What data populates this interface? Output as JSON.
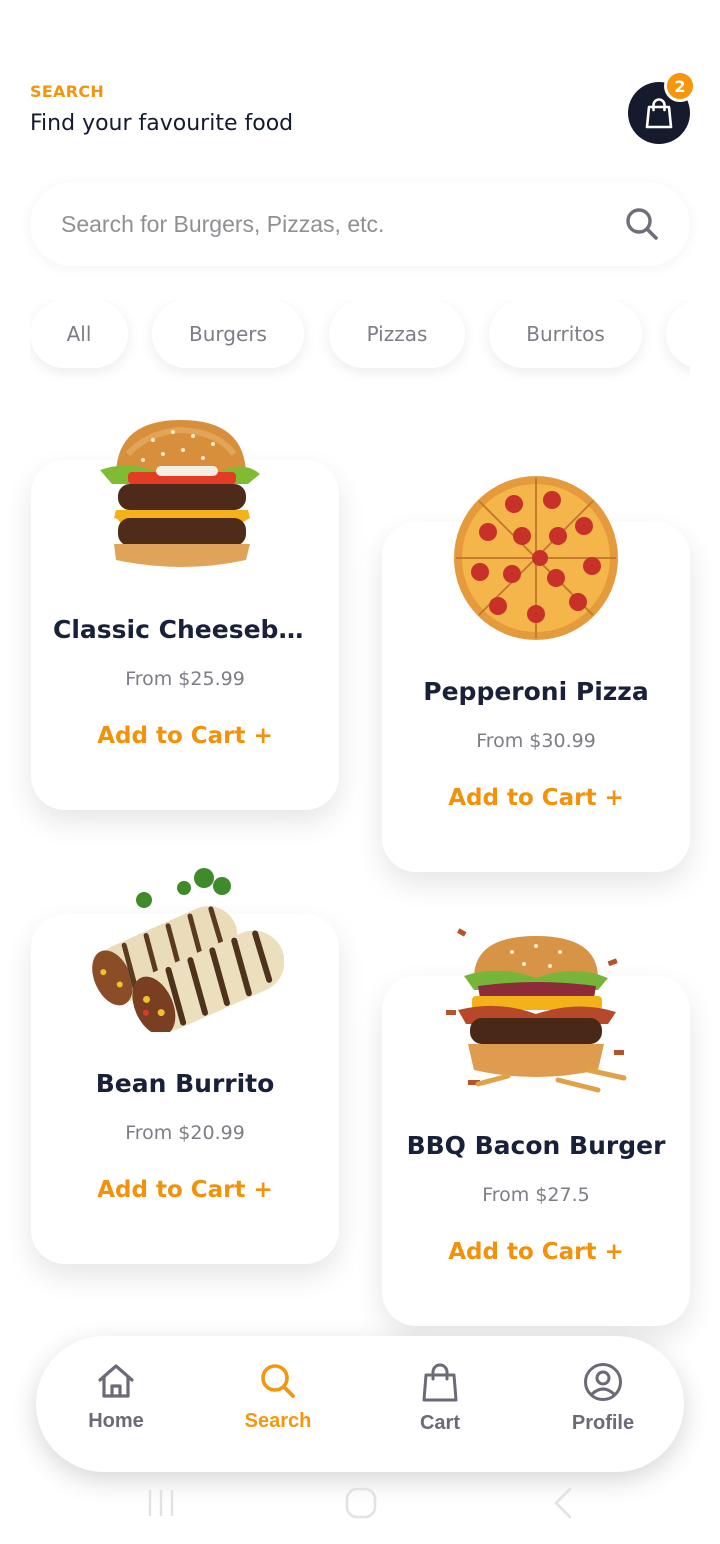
{
  "header": {
    "eyebrow": "SEARCH",
    "title": "Find your favourite food"
  },
  "cart_fab": {
    "icon": "shopping-bag-icon",
    "badge_count": "2"
  },
  "search": {
    "placeholder": "Search for Burgers, Pizzas, etc.",
    "value": "",
    "icon": "search-icon"
  },
  "categories": [
    "All",
    "Burgers",
    "Pizzas",
    "Burritos"
  ],
  "products": [
    {
      "name": "Classic Cheeseburger",
      "price": "From $25.99",
      "action": "Add to Cart +"
    },
    {
      "name": "Pepperoni Pizza",
      "price": "From $30.99",
      "action": "Add to Cart +"
    },
    {
      "name": "Bean Burrito",
      "price": "From $20.99",
      "action": "Add to Cart +"
    },
    {
      "name": "BBQ Bacon Burger",
      "price": "From $27.5",
      "action": "Add to Cart +"
    }
  ],
  "bottom_nav": [
    {
      "label": "Home",
      "icon": "home-icon",
      "active": false
    },
    {
      "label": "Search",
      "icon": "search-icon",
      "active": true
    },
    {
      "label": "Cart",
      "icon": "shopping-bag-icon",
      "active": false
    },
    {
      "label": "Profile",
      "icon": "user-circle-icon",
      "active": false
    }
  ],
  "colors": {
    "accent": "#f5960c",
    "dark": "#151a2d",
    "inactive_nav": "#6a6b76"
  }
}
